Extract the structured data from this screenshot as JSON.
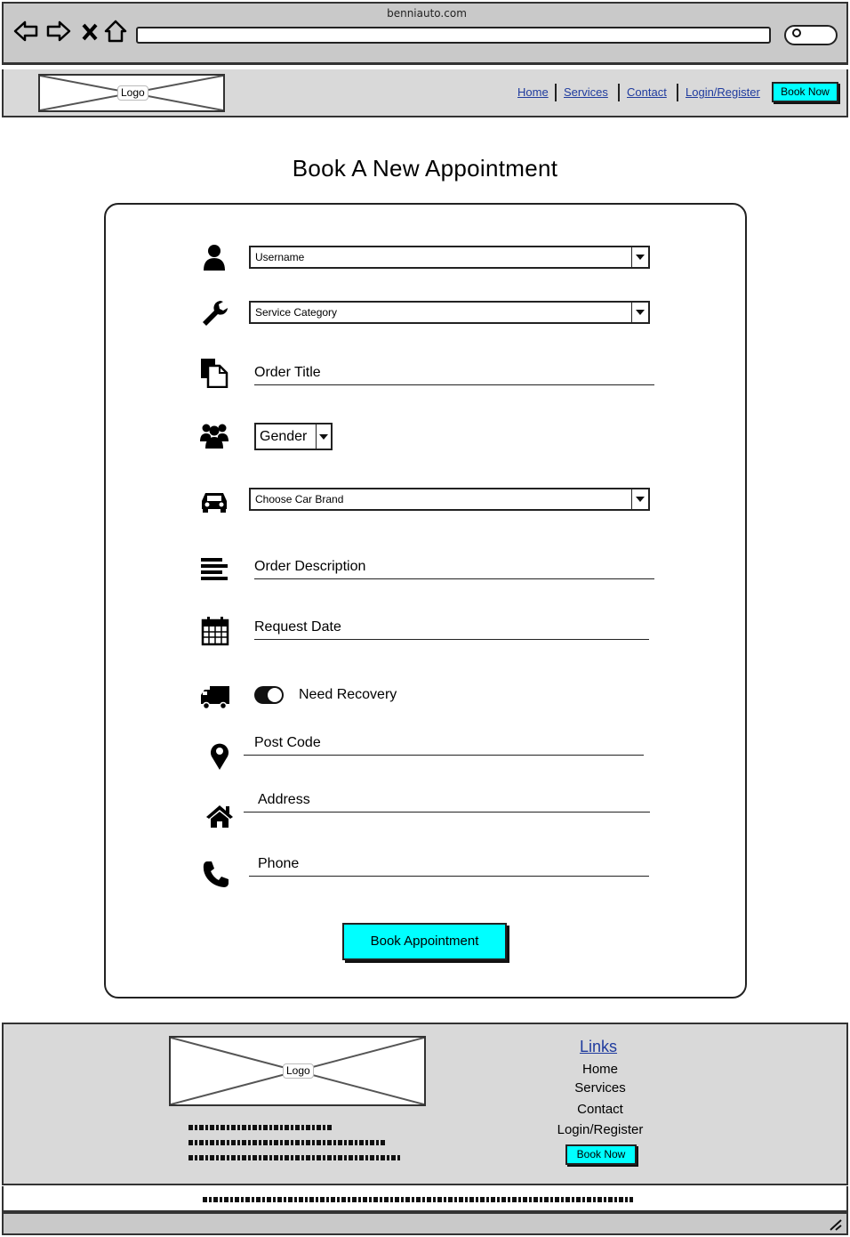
{
  "browser": {
    "url": "benniauto.com",
    "icons": [
      "back-arrow-icon",
      "forward-arrow-icon",
      "close-x-icon",
      "home-icon",
      "search-icon"
    ]
  },
  "header": {
    "logo_label": "Logo",
    "nav": [
      "Home",
      "Services",
      "Contact",
      "Login/Register"
    ],
    "cta_label": "Book Now"
  },
  "main": {
    "title": "Book A New Appointment",
    "fields": {
      "username": {
        "icon": "user-icon",
        "value": "Username"
      },
      "service_category": {
        "icon": "wrench-icon",
        "value": "Service Category"
      },
      "order_title": {
        "icon": "document-icon",
        "label": "Order Title"
      },
      "gender": {
        "icon": "group-icon",
        "value": "Gender"
      },
      "car_brand": {
        "icon": "car-icon",
        "value": "Choose Car Brand"
      },
      "order_description": {
        "icon": "align-lines-icon",
        "label": "Order Description"
      },
      "request_date": {
        "icon": "calendar-icon",
        "label": "Request Date"
      },
      "need_recovery": {
        "icon": "truck-icon",
        "label": "Need Recovery",
        "on": true
      },
      "post_code": {
        "icon": "map-pin-icon",
        "label": "Post Code"
      },
      "address": {
        "icon": "home-icon",
        "label": "Address"
      },
      "phone": {
        "icon": "phone-icon",
        "label": "Phone"
      }
    },
    "submit_label": "Book Appointment"
  },
  "footer": {
    "logo_label": "Logo",
    "links_title": "Links",
    "links": [
      "Home",
      "Services",
      "Contact",
      "Login/Register"
    ],
    "cta_label": "Book Now"
  },
  "colors": {
    "accent": "#00ffff",
    "link": "#1f3b9e",
    "header_bg": "#d9d9d9",
    "chrome_bg": "#c9c9c9"
  }
}
